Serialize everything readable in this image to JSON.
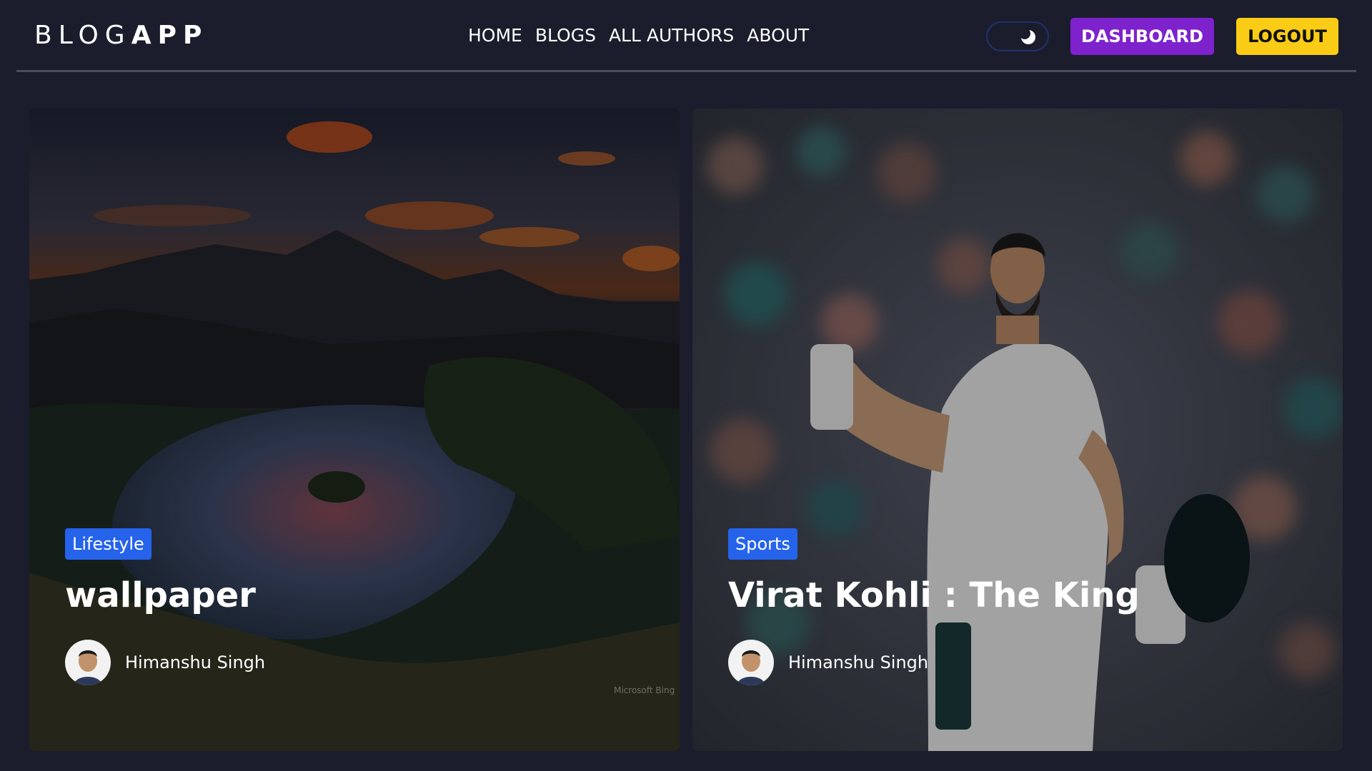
{
  "header": {
    "logo_part1": "BLOG",
    "logo_part2": "APP",
    "nav": [
      "HOME",
      "BLOGS",
      "ALL AUTHORS",
      "ABOUT"
    ],
    "theme_toggle_icon": "moon-icon",
    "dashboard_label": "DASHBOARD",
    "logout_label": "LOGOUT"
  },
  "colors": {
    "background": "#1b1d2d",
    "dashboard": "#7e22ce",
    "logout": "#facc15",
    "tag": "#2563eb"
  },
  "cards": [
    {
      "category": "Lifestyle",
      "title": "wallpaper",
      "author": "Himanshu Singh",
      "watermark": "Microsoft Bing"
    },
    {
      "category": "Sports",
      "title": "Virat Kohli : The King",
      "author": "Himanshu Singh"
    }
  ]
}
